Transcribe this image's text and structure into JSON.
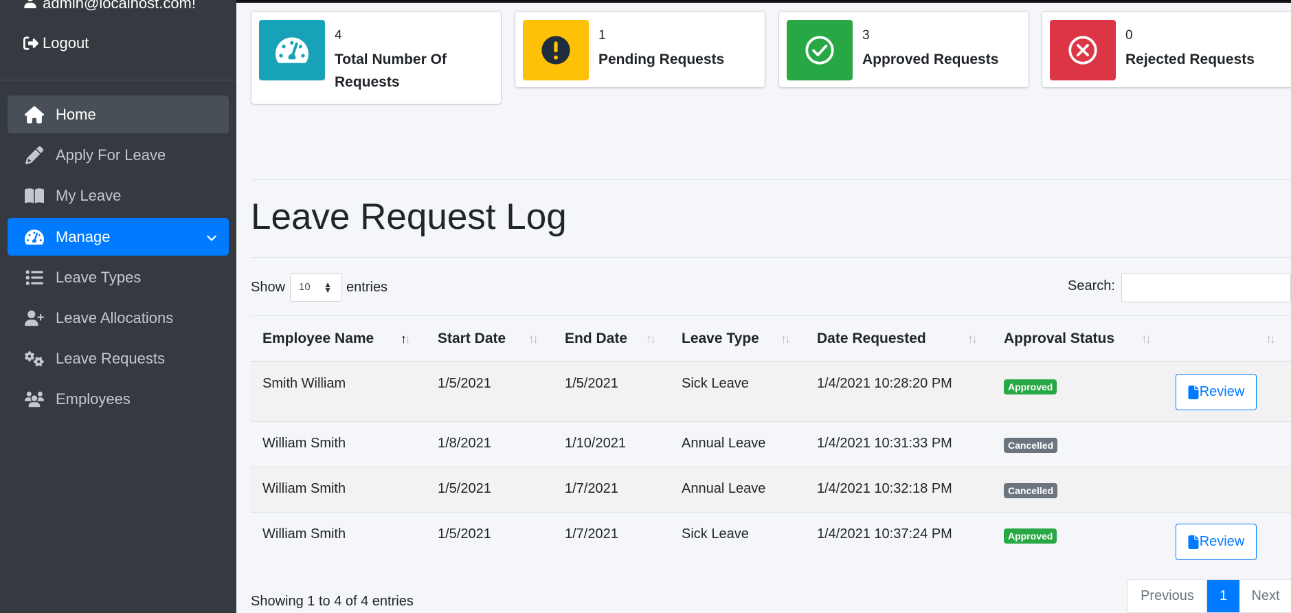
{
  "sidebar": {
    "user_email": "admin@localhost.com!",
    "logout": "Logout",
    "items": [
      {
        "label": "Home",
        "icon": "home-icon"
      },
      {
        "label": "Apply For Leave",
        "icon": "pencil-icon"
      },
      {
        "label": "My Leave",
        "icon": "book-icon"
      },
      {
        "label": "Manage",
        "icon": "tachometer-icon"
      },
      {
        "label": "Leave Types",
        "icon": "list-icon"
      },
      {
        "label": "Leave Allocations",
        "icon": "user-plus-icon"
      },
      {
        "label": "Leave Requests",
        "icon": "cogs-icon"
      },
      {
        "label": "Employees",
        "icon": "users-icon"
      }
    ]
  },
  "stats": [
    {
      "value": "4",
      "label": "Total Number Of Requests",
      "color": "#17a2b8",
      "icon": "tachometer-icon"
    },
    {
      "value": "1",
      "label": "Pending Requests",
      "color": "#ffc107",
      "icon": "exclamation-circle-icon"
    },
    {
      "value": "3",
      "label": "Approved Requests",
      "color": "#28a745",
      "icon": "check-circle-icon"
    },
    {
      "value": "0",
      "label": "Rejected Requests",
      "color": "#dc3545",
      "icon": "times-circle-icon"
    }
  ],
  "main": {
    "title": "Leave Request Log",
    "show_label": "Show",
    "entries_value": "10",
    "entries_label": "entries",
    "search_label": "Search:",
    "search_value": ""
  },
  "table": {
    "columns": [
      "Employee Name",
      "Start Date",
      "End Date",
      "Leave Type",
      "Date Requested",
      "Approval Status",
      ""
    ],
    "rows": [
      {
        "name": "Smith William",
        "start": "1/5/2021",
        "end": "1/5/2021",
        "type": "Sick Leave",
        "requested": "1/4/2021 10:28:20 PM",
        "status": "Approved",
        "action": "Review"
      },
      {
        "name": "William Smith",
        "start": "1/8/2021",
        "end": "1/10/2021",
        "type": "Annual Leave",
        "requested": "1/4/2021 10:31:33 PM",
        "status": "Cancelled",
        "action": ""
      },
      {
        "name": "William Smith",
        "start": "1/5/2021",
        "end": "1/7/2021",
        "type": "Annual Leave",
        "requested": "1/4/2021 10:32:18 PM",
        "status": "Cancelled",
        "action": ""
      },
      {
        "name": "William Smith",
        "start": "1/5/2021",
        "end": "1/7/2021",
        "type": "Sick Leave",
        "requested": "1/4/2021 10:37:24 PM",
        "status": "Approved",
        "action": "Review"
      }
    ]
  },
  "footer": {
    "showing": "Showing 1 to 4 of 4 entries",
    "previous": "Previous",
    "page": "1",
    "next": "Next"
  }
}
